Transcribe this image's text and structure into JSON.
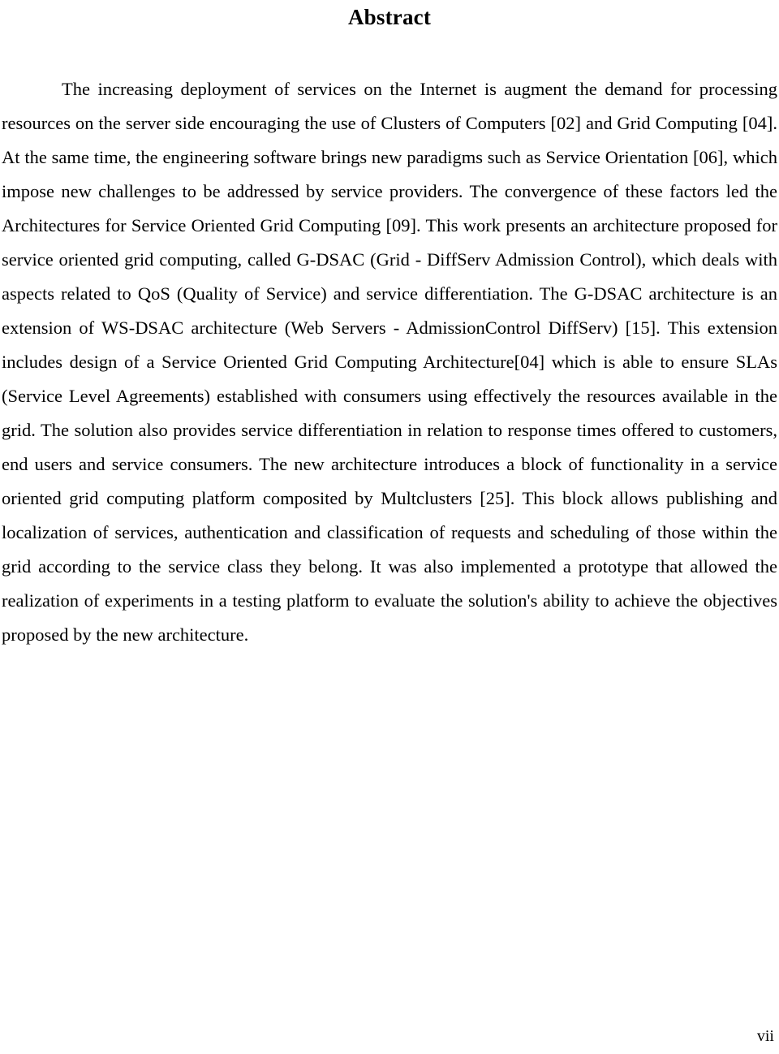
{
  "document": {
    "heading": "Abstract",
    "body_paragraph": "The increasing deployment of services on the Internet is augment the demand for processing resources on the server side encouraging the use of Clusters of Computers [02] and Grid Computing [04]. At the same time, the engineering software brings new paradigms such as Service Orientation [06], which impose new challenges to be addressed by service providers. The convergence of these factors led the Architectures for Service Oriented Grid Computing [09]. This work presents an architecture proposed for service oriented grid computing, called G-DSAC (Grid - DiffServ Admission Control), which deals with aspects related to QoS (Quality of Service) and service differentiation. The G-DSAC architecture is an extension of WS-DSAC architecture (Web Servers - AdmissionControl DiffServ) [15]. This extension includes design of a Service Oriented Grid Computing Architecture[04] which is able to ensure SLAs (Service Level Agreements) established with consumers using effectively the resources available in the grid. The solution also provides service differentiation in relation to response times offered to customers, end users and service consumers. The new architecture introduces a block of functionality in a service oriented grid computing platform composited by Multclusters [25]. This block allows publishing and localization of services, authentication and classification of requests and scheduling of those within the grid according to the service class they belong. It was also implemented a prototype that allowed the realization of experiments in a testing platform to evaluate the solution's ability to achieve the objectives proposed by the new architecture.",
    "page_number": "vii"
  }
}
